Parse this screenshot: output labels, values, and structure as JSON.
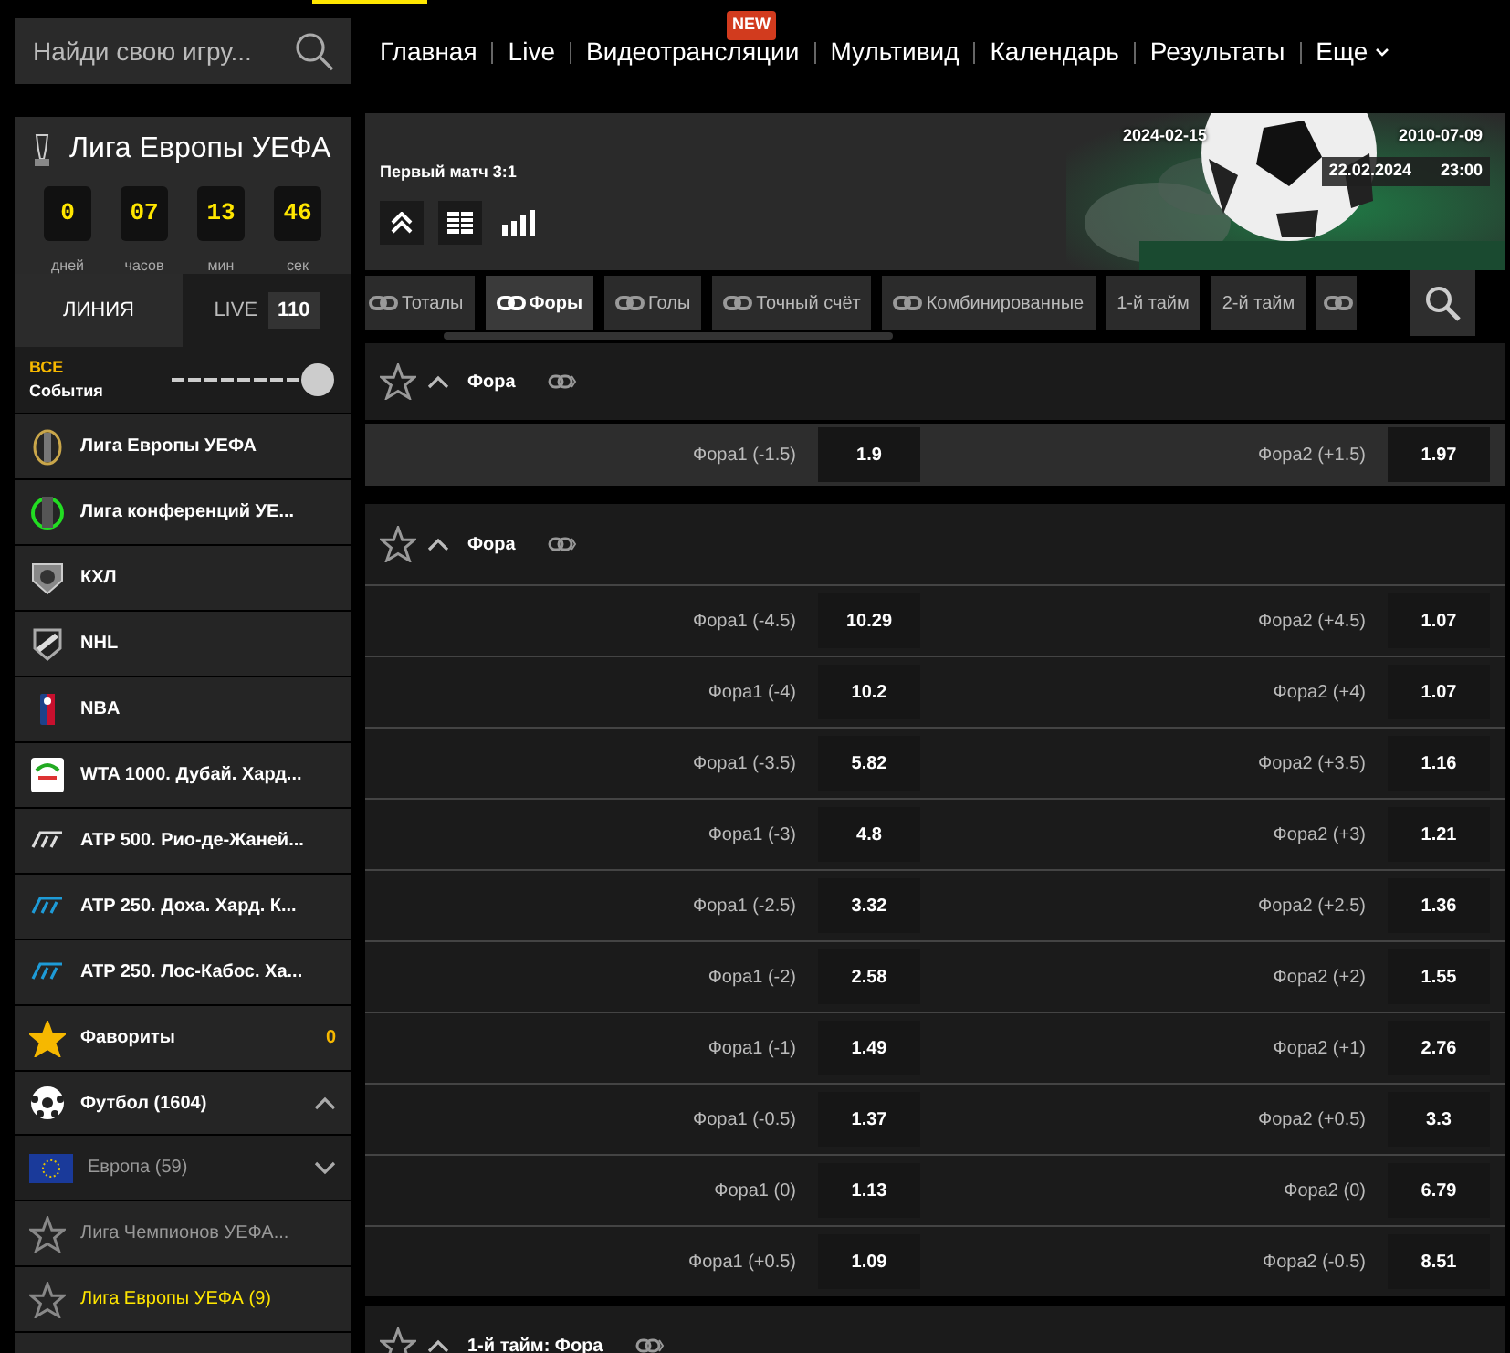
{
  "header": {
    "search": {
      "placeholder": "Найди свою игру..."
    },
    "nav": [
      {
        "label": "Главная"
      },
      {
        "label": "Live"
      },
      {
        "label": "Видеотрансляции",
        "badge": "NEW"
      },
      {
        "label": "Мультивид"
      },
      {
        "label": "Календарь"
      },
      {
        "label": "Результаты"
      }
    ],
    "more": "Еще"
  },
  "sidebar": {
    "league": {
      "title": "Лига Европы УЕФА",
      "timer": [
        {
          "value": "0",
          "unit": "дней"
        },
        {
          "value": "07",
          "unit": "часов"
        },
        {
          "value": "13",
          "unit": "мин"
        },
        {
          "value": "46",
          "unit": "сек"
        }
      ]
    },
    "tabs": [
      {
        "label": "ЛИНИЯ",
        "selected": true
      },
      {
        "label": "LIVE",
        "count": "110",
        "selected": false
      }
    ],
    "filter": {
      "top": "ВСЕ",
      "bottom": "События",
      "on": true
    },
    "items": [
      {
        "kind": "league",
        "label": "Лига Европы УЕФА"
      },
      {
        "kind": "league",
        "label": "Лига конференций УЕ..."
      },
      {
        "kind": "league",
        "label": "КХЛ"
      },
      {
        "kind": "league",
        "label": "NHL"
      },
      {
        "kind": "league",
        "label": "NBA"
      },
      {
        "kind": "league",
        "label": "WTA 1000. Дубай. Хард..."
      },
      {
        "kind": "league",
        "label": "ATP 500. Рио-де-Жаней..."
      },
      {
        "kind": "league",
        "label": "ATP 250. Доха. Хард. К..."
      },
      {
        "kind": "league",
        "label": "ATP 250. Лос-Кабос. Ха..."
      },
      {
        "kind": "favorites",
        "label": "Фавориты",
        "count": "0"
      },
      {
        "kind": "sport",
        "label": "Футбол (1604)",
        "expanded": true
      },
      {
        "kind": "region",
        "label": "Европа (59)",
        "expanded": false
      },
      {
        "kind": "tournament",
        "label": "Лига Чемпионов УЕФА...",
        "selected": false
      },
      {
        "kind": "tournament",
        "label": "Лига Европы УЕФА (9)",
        "selected": true
      }
    ]
  },
  "event": {
    "note": "Первый матч 3:1",
    "date_left": "2024-02-15",
    "date_right": "2010-07-09",
    "date": "22.02.2024",
    "time": "23:00"
  },
  "market_tabs": [
    {
      "label": "Тоталы",
      "linked": true,
      "selected": false
    },
    {
      "label": "Форы",
      "linked": true,
      "selected": true
    },
    {
      "label": "Голы",
      "linked": true,
      "selected": false
    },
    {
      "label": "Точный счёт",
      "linked": true,
      "selected": false
    },
    {
      "label": "Комбинированные",
      "linked": true,
      "selected": false
    },
    {
      "label": "1-й тайм",
      "linked": false,
      "selected": false
    },
    {
      "label": "2-й тайм",
      "linked": false,
      "selected": false
    },
    {
      "kind": "cut",
      "linked": true
    }
  ],
  "markets": [
    {
      "title": "Фора",
      "favorite": false,
      "expanded": true,
      "rows": [
        {
          "left_label": "Фора1 (-1.5)",
          "left_odd": "1.9",
          "right_label": "Фора2 (+1.5)",
          "right_odd": "1.97"
        }
      ]
    },
    {
      "title": "Фора",
      "favorite": false,
      "expanded": true,
      "rows": [
        {
          "left_label": "Фора1 (-4.5)",
          "left_odd": "10.29",
          "right_label": "Фора2 (+4.5)",
          "right_odd": "1.07"
        },
        {
          "left_label": "Фора1 (-4)",
          "left_odd": "10.2",
          "right_label": "Фора2 (+4)",
          "right_odd": "1.07"
        },
        {
          "left_label": "Фора1 (-3.5)",
          "left_odd": "5.82",
          "right_label": "Фора2 (+3.5)",
          "right_odd": "1.16"
        },
        {
          "left_label": "Фора1 (-3)",
          "left_odd": "4.8",
          "right_label": "Фора2 (+3)",
          "right_odd": "1.21"
        },
        {
          "left_label": "Фора1 (-2.5)",
          "left_odd": "3.32",
          "right_label": "Фора2 (+2.5)",
          "right_odd": "1.36"
        },
        {
          "left_label": "Фора1 (-2)",
          "left_odd": "2.58",
          "right_label": "Фора2 (+2)",
          "right_odd": "1.55"
        },
        {
          "left_label": "Фора1 (-1)",
          "left_odd": "1.49",
          "right_label": "Фора2 (+1)",
          "right_odd": "2.76"
        },
        {
          "left_label": "Фора1 (-0.5)",
          "left_odd": "1.37",
          "right_label": "Фора2 (+0.5)",
          "right_odd": "3.3"
        },
        {
          "left_label": "Фора1 (0)",
          "left_odd": "1.13",
          "right_label": "Фора2 (0)",
          "right_odd": "6.79"
        },
        {
          "left_label": "Фора1 (+0.5)",
          "left_odd": "1.09",
          "right_label": "Фора2 (-0.5)",
          "right_odd": "8.51"
        }
      ]
    },
    {
      "title": "1-й тайм: Фора",
      "favorite": false,
      "expanded": true
    }
  ]
}
